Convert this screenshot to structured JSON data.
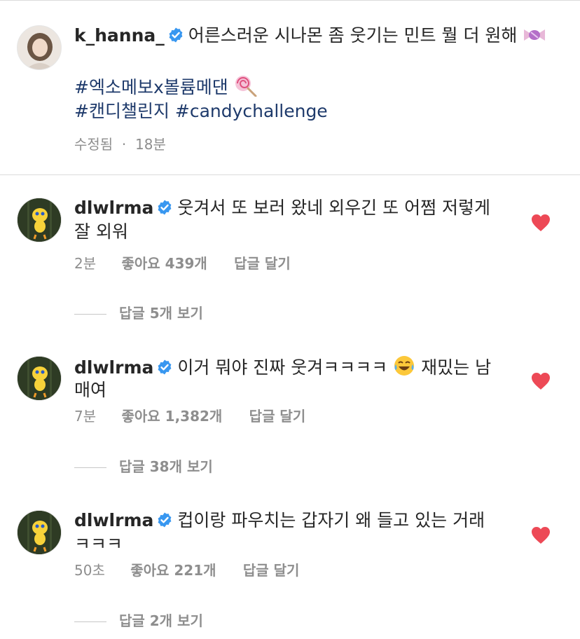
{
  "caption": {
    "username": "k_hanna_",
    "text": "어른스러운 시나몬 좀 웃기는 민트 뭘 더 원해",
    "hashtags_line1": "#엑소메보x볼륨메댄",
    "hashtags_line2": "#캔디챌린지 #candychallenge",
    "edited": "수정됨",
    "time": "18분"
  },
  "comments": [
    {
      "username": "dlwlrma",
      "line1": "웃겨서 또 보러 왔네 외우긴 또 어쩜 저렇게",
      "line2": "잘 외워",
      "time": "2분",
      "likes": "좋아요 439개",
      "reply": "답글 달기",
      "view_replies": "답글 5개 보기"
    },
    {
      "username": "dlwlrma",
      "line1": "이거 뭐야 진짜 웃겨ㅋㅋㅋㅋ",
      "line1b": "재밌는 남",
      "line2": "매여",
      "time": "7분",
      "likes": "좋아요 1,382개",
      "reply": "답글 달기",
      "view_replies": "답글 38개 보기"
    },
    {
      "username": "dlwlrma",
      "line1": "컵이랑 파우치는 갑자기 왜 들고 있는 거래",
      "line2": "ㅋㅋㅋ",
      "time": "50초",
      "likes": "좋아요 221개",
      "reply": "답글 달기",
      "view_replies": "답글 2개 보기"
    }
  ],
  "icons": {
    "verified": "verified-badge-icon",
    "heart": "heart-icon",
    "candy": "candy-emoji",
    "lollipop": "lollipop-emoji",
    "laugh": "tears-of-joy-emoji"
  },
  "colors": {
    "verified": "#3897f0",
    "heart": "#ed4956",
    "hashtag": "#1e3a6b",
    "meta": "#8e8e8e"
  }
}
